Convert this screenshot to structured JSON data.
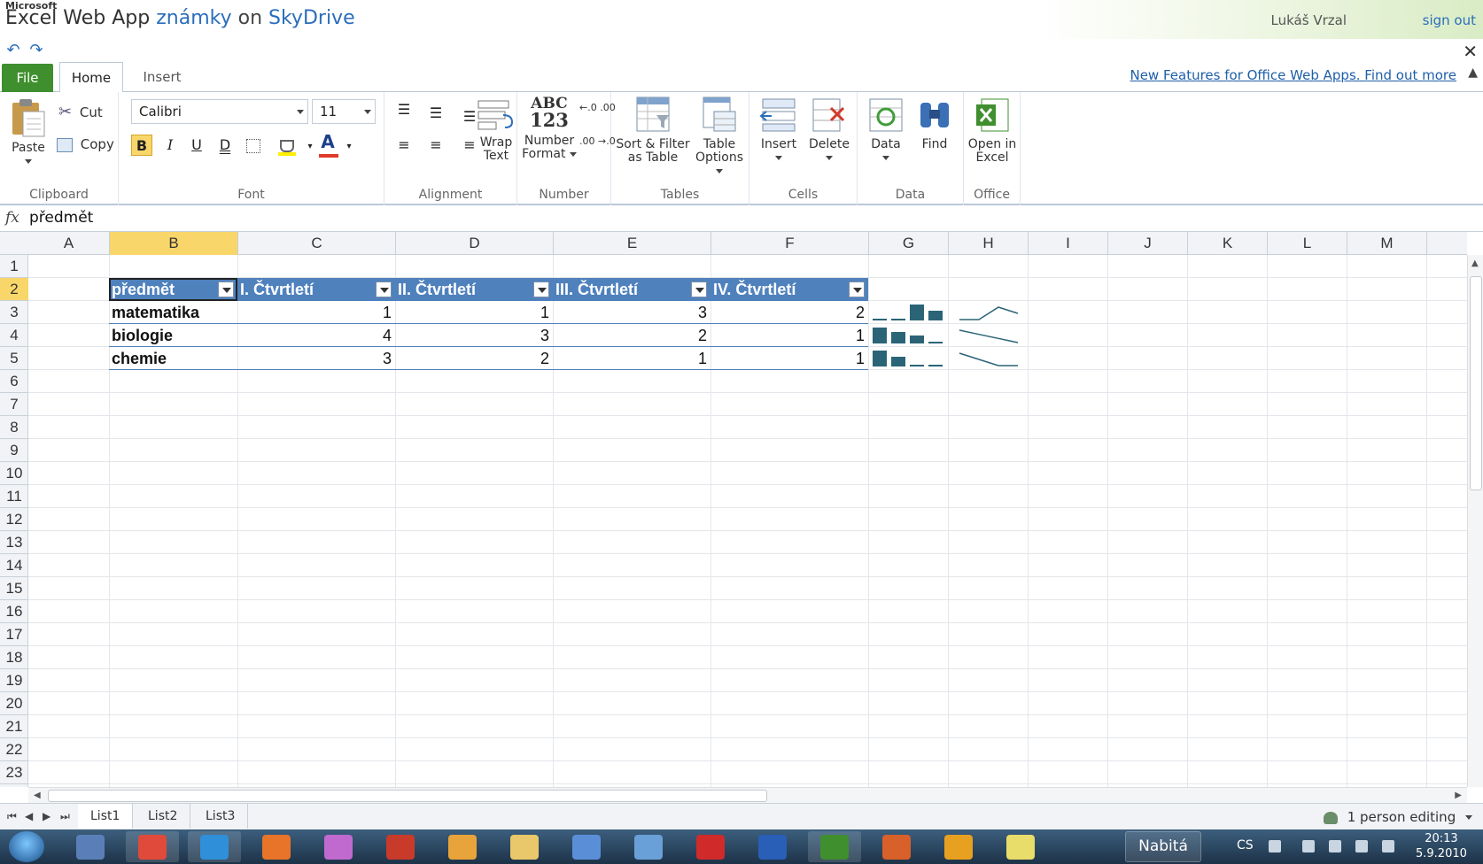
{
  "window": {
    "brand": "Microsoft",
    "app_name": "Excel Web App",
    "doc_name": "známky",
    "on_word": "on",
    "service": "SkyDrive",
    "user": "Lukáš Vrzal",
    "sign_out": "sign out"
  },
  "tabs": {
    "file": "File",
    "home": "Home",
    "insert": "Insert"
  },
  "new_features_link": "New Features for Office Web Apps. Find out more",
  "ribbon": {
    "clipboard": {
      "label": "Clipboard",
      "paste": "Paste",
      "cut": "Cut",
      "copy": "Copy"
    },
    "font": {
      "label": "Font",
      "family": "Calibri",
      "size": "11",
      "bold": "B",
      "italic": "I",
      "underline": "U",
      "double_underline": "D",
      "font_color_glyph": "A"
    },
    "alignment": {
      "label": "Alignment",
      "wrap_line1": "Wrap",
      "wrap_line2": "Text"
    },
    "number": {
      "label": "Number",
      "fmt_line1": "Number",
      "fmt_line2": "Format",
      "abc": "ABC",
      "n123": "123",
      "inc_decimal": "←.0 .00",
      "dec_decimal": ".00 →.0"
    },
    "tables": {
      "label": "Tables",
      "sort_line1": "Sort & Filter",
      "sort_line2": "as Table",
      "opt_line1": "Table",
      "opt_line2": "Options"
    },
    "cells": {
      "label": "Cells",
      "insert": "Insert",
      "delete": "Delete"
    },
    "data": {
      "label": "Data",
      "data": "Data",
      "find": "Find"
    },
    "office": {
      "label": "Office",
      "open_line1": "Open in",
      "open_line2": "Excel"
    }
  },
  "formula_bar": {
    "fx": "fx",
    "value": "předmět"
  },
  "grid": {
    "columns": [
      "A",
      "B",
      "C",
      "D",
      "E",
      "F",
      "G",
      "H",
      "I",
      "J",
      "K",
      "L",
      "M"
    ],
    "rows": [
      "1",
      "2",
      "3",
      "4",
      "5",
      "6",
      "7",
      "8",
      "9",
      "10",
      "11",
      "12",
      "13",
      "14",
      "15",
      "16",
      "17",
      "18",
      "19",
      "20",
      "21",
      "22",
      "23"
    ],
    "selected_column": "B",
    "selected_row": "2"
  },
  "table": {
    "headers": [
      "předmět",
      "I. Čtvrtletí",
      "II. Čtvrtletí",
      "III. Čtvrtletí",
      "IV. Čtvrtletí"
    ],
    "rows": [
      {
        "name": "matematika",
        "values": [
          "1",
          "1",
          "3",
          "2"
        ]
      },
      {
        "name": "biologie",
        "values": [
          "4",
          "3",
          "2",
          "1"
        ]
      },
      {
        "name": "chemie",
        "values": [
          "3",
          "2",
          "1",
          "1"
        ]
      }
    ],
    "sparkline_color": "#2b6477",
    "header_color": "#4f81bd"
  },
  "sheets": [
    "List1",
    "List2",
    "List3"
  ],
  "active_sheet": "List1",
  "status": {
    "editing": "1 person editing"
  },
  "taskbar": {
    "battery_label": "Nabitá",
    "lang": "CS",
    "time": "20:13",
    "date": "5.9.2010"
  }
}
